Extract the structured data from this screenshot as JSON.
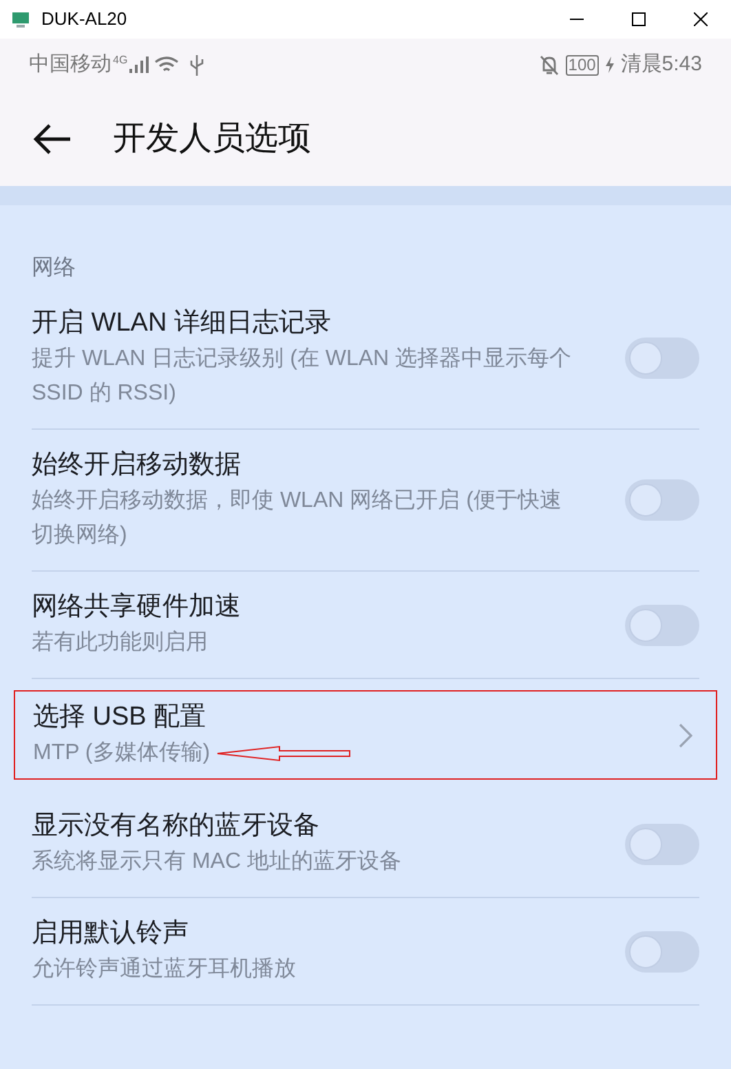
{
  "window": {
    "title": "DUK-AL20"
  },
  "status_bar": {
    "carrier": "中国移动",
    "network": "4G",
    "battery": "100",
    "time": "清晨5:43"
  },
  "header": {
    "title": "开发人员选项"
  },
  "section": {
    "title": "网络"
  },
  "items": [
    {
      "kind": "toggle",
      "title": "开启 WLAN 详细日志记录",
      "subtitle": "提升 WLAN 日志记录级别 (在 WLAN 选择器中显示每个 SSID 的 RSSI)",
      "on": false,
      "highlighted": false
    },
    {
      "kind": "toggle",
      "title": "始终开启移动数据",
      "subtitle": "始终开启移动数据，即使 WLAN 网络已开启 (便于快速切换网络)",
      "on": false,
      "highlighted": false
    },
    {
      "kind": "toggle",
      "title": "网络共享硬件加速",
      "subtitle": "若有此功能则启用",
      "on": false,
      "highlighted": false
    },
    {
      "kind": "link",
      "title": "选择 USB 配置",
      "subtitle": "MTP (多媒体传输)",
      "highlighted": true
    },
    {
      "kind": "toggle",
      "title": "显示没有名称的蓝牙设备",
      "subtitle": "系统将显示只有 MAC 地址的蓝牙设备",
      "on": false,
      "highlighted": false
    },
    {
      "kind": "toggle",
      "title": "启用默认铃声",
      "subtitle": "允许铃声通过蓝牙耳机播放",
      "on": false,
      "highlighted": false
    }
  ]
}
